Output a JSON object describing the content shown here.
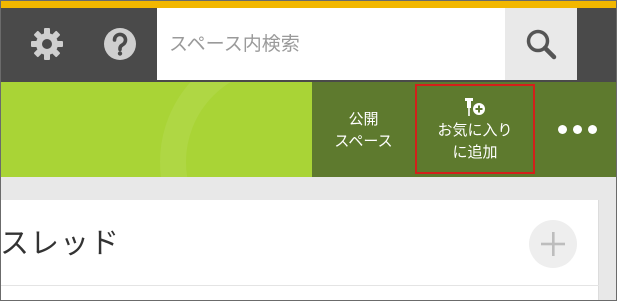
{
  "header": {
    "settings_icon": "gear-icon",
    "help_icon": "question-circle-icon",
    "search": {
      "placeholder": "スペース内検索",
      "button_icon": "search-icon"
    },
    "stripe_color": "#f2b700",
    "bar_color": "#4a4a4a"
  },
  "banner": {
    "color": "#a9d436",
    "actions_color": "#5e7a2e",
    "public_space": {
      "line1": "公開",
      "line2": "スペース"
    },
    "favorite": {
      "icon": "pin-plus-icon",
      "line1": "お気に入り",
      "line2": "に追加",
      "highlight_color": "#d3201b"
    },
    "more_icon": "more-dots-icon"
  },
  "card": {
    "title": "スレッド",
    "add_icon": "plus-icon"
  }
}
